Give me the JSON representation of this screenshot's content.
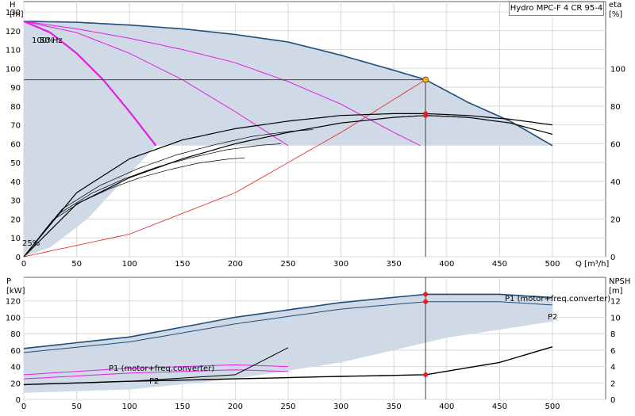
{
  "chart_data": [
    {
      "type": "line",
      "title": "Hydro MPC-F 4 CR 95-4",
      "xlabel": "Q [m³/h]",
      "ylabel_left": "H",
      "ylabel_left_unit": "[m]",
      "ylabel_right": "eta",
      "ylabel_right_unit": "[%]",
      "xlim": [
        0,
        500
      ],
      "ylim": [
        0,
        130
      ],
      "ylim_right": [
        0,
        130
      ],
      "xticks": [
        0,
        50,
        100,
        150,
        200,
        250,
        300,
        350,
        400,
        450,
        500
      ],
      "yticks_left": [
        0,
        10,
        20,
        30,
        40,
        50,
        60,
        70,
        80,
        90,
        100,
        110,
        120,
        130
      ],
      "yticks_right": [
        0,
        20,
        40,
        60,
        80,
        100
      ],
      "grid": true,
      "speed_labels": [
        "100%",
        "50 Hz"
      ],
      "min_speed_label": "25%",
      "operating_point": {
        "Q": 380,
        "H": 94
      },
      "series": [
        {
          "x": [
            0,
            50,
            100,
            150,
            200,
            250,
            300,
            350,
            380,
            420,
            460,
            500
          ],
          "values": [
            125,
            124.5,
            123,
            121,
            118,
            114,
            107,
            99,
            94,
            82,
            72,
            59
          ]
        },
        {
          "x": [
            0,
            50,
            100,
            150,
            200,
            250,
            300,
            350,
            375
          ],
          "values": [
            125,
            121,
            116,
            110,
            103,
            93,
            81,
            66,
            59
          ]
        },
        {
          "x": [
            0,
            50,
            100,
            150,
            200,
            250
          ],
          "values": [
            125,
            119,
            108,
            94,
            77,
            59
          ]
        },
        {
          "x": [
            0,
            25,
            50,
            75,
            100,
            125
          ],
          "values": [
            125,
            119,
            108,
            94,
            77,
            59
          ]
        },
        {
          "x": [
            0,
            100,
            200,
            300,
            380
          ],
          "values": [
            0,
            12,
            34,
            66,
            94
          ]
        },
        {
          "x": [
            0,
            50,
            100,
            150,
            200,
            250,
            300,
            350,
            380,
            420,
            460,
            500
          ],
          "values_right": [
            0,
            34,
            52,
            62,
            68,
            72,
            75,
            76,
            76,
            75,
            73,
            70
          ]
        },
        {
          "x": [
            0,
            50,
            100,
            150,
            200,
            250,
            300,
            350,
            380,
            420,
            460,
            500
          ],
          "values_right": [
            0,
            28,
            42,
            52,
            60,
            66,
            71,
            74,
            75,
            74,
            71,
            65
          ]
        }
      ]
    },
    {
      "type": "line",
      "xlabel": "",
      "ylabel_left": "P",
      "ylabel_left_unit": "[kW]",
      "ylabel_right": "NPSH",
      "ylabel_right_unit": "[m]",
      "xlim": [
        0,
        500
      ],
      "ylim": [
        0,
        140
      ],
      "ylim_right": [
        0,
        14
      ],
      "xticks": [
        0,
        50,
        100,
        150,
        200,
        250,
        300,
        350,
        400,
        450,
        500
      ],
      "yticks_left": [
        0,
        20,
        40,
        60,
        80,
        100,
        120
      ],
      "yticks_right": [
        0,
        2,
        4,
        6,
        8,
        10,
        12
      ],
      "grid": true,
      "series": [
        {
          "name": "P1 (motor+freq.converter)",
          "x": [
            0,
            100,
            200,
            300,
            380,
            450,
            500
          ],
          "values": [
            62,
            76,
            100,
            118,
            128,
            128,
            124
          ]
        },
        {
          "name": "P2",
          "x": [
            0,
            100,
            200,
            300,
            380,
            450,
            500
          ],
          "values": [
            57,
            70,
            92,
            110,
            119,
            119,
            115
          ]
        },
        {
          "name": "P1 (motor+freq.converter)",
          "x": [
            0,
            100,
            200,
            250
          ],
          "values": [
            30,
            38,
            42,
            40
          ]
        },
        {
          "name": "P2",
          "x": [
            0,
            100,
            200,
            250
          ],
          "values": [
            25,
            32,
            36,
            34
          ]
        },
        {
          "x": [
            0,
            100,
            200,
            300,
            380,
            450,
            500
          ],
          "values_right": [
            1.8,
            2.2,
            2.5,
            2.8,
            3.0,
            4.5,
            6.4
          ]
        },
        {
          "x": [
            0,
            100,
            200,
            250
          ],
          "values_right": [
            1.8,
            2.2,
            3.0,
            6.3
          ]
        }
      ],
      "annotations": [
        "P1 (motor+freq.converter)",
        "P2",
        "P1 (motor+freq.converter)",
        "P2"
      ]
    }
  ]
}
